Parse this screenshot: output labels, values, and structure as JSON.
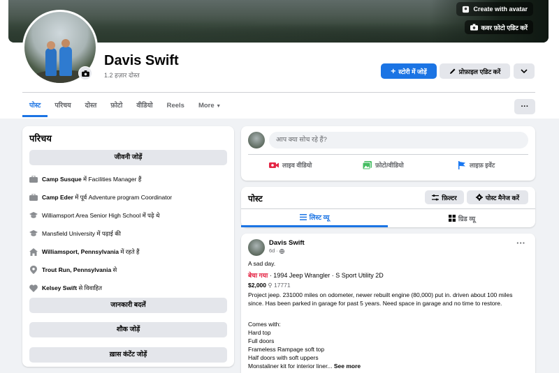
{
  "cover": {
    "create_avatar": "Create with avatar",
    "edit_cover": "कवर फ़ोटो एडिट करें"
  },
  "profile": {
    "name": "Davis Swift",
    "friends": "1.2 हज़ार दोस्त",
    "add_story": "स्टोरी में जोड़ें",
    "edit_profile": "प्रोफ़ाइल एडिट करें"
  },
  "tabs": [
    {
      "label": "पोस्ट"
    },
    {
      "label": "परिचय"
    },
    {
      "label": "दोस्त"
    },
    {
      "label": "फ़ोटो"
    },
    {
      "label": "वीडियो"
    },
    {
      "label": "Reels"
    },
    {
      "label": "More"
    }
  ],
  "intro": {
    "title": "परिचय",
    "add_bio": "जीवनी जोड़ें",
    "items": [
      {
        "bold": "Camp Susque",
        "rest": " में Facilities Manager हैं"
      },
      {
        "bold": "Camp Eder",
        "rest": " में पूर्व Adventure program Coordinator"
      },
      {
        "bold": "",
        "rest": "Williamsport Area Senior High School में पढ़े थे"
      },
      {
        "bold": "",
        "rest": "Mansfield University में पढ़ाई की"
      },
      {
        "bold": "Williamsport, Pennsylvania",
        "rest": " में रहते हैं"
      },
      {
        "bold": "Trout Run, Pennsylvania",
        "rest": " से"
      },
      {
        "bold": "Kelsey Swift",
        "rest": " से विवाहित"
      }
    ],
    "edit_details": "जानकारी बदलें",
    "add_hobbies": "शौक जोड़ें",
    "add_featured": "ख़ास कंटेंट जोड़ें"
  },
  "composer": {
    "placeholder": "आप क्या सोच रहे हैं?",
    "live": "लाइव वीडियो",
    "photo": "फ़ोटो/वीडियो",
    "event": "लाइफ़ इवेंट"
  },
  "posts_header": {
    "title": "पोस्ट",
    "filter": "फ़िल्टर",
    "manage": "पोस्ट मैनेज करें",
    "list_view": "लिस्ट व्यू",
    "grid_view": "ग्रिड व्यू"
  },
  "post": {
    "author": "Davis Swift",
    "time": "6d · ",
    "text": "A sad day.",
    "sold": "बेचा गया",
    "listing": " · 1994 Jeep Wrangler · S Sport Utility 2D",
    "price": "$2,000",
    "location": "17771",
    "description": "Project jeep. 231000 miles on odometer, newer rebuilt engine (80,000) put in. driven about 100 miles since. Has been parked in garage for past 5 years. Need space in garage and no time to restore.",
    "comes_with": "Comes with:",
    "item1": "Hard top",
    "item2": "Full doors",
    "item3": "Frameless Rampage soft top",
    "item4": "Half doors with soft uppers",
    "item5": "Monstaliner kit for interior liner...",
    "see_more": " See more"
  },
  "colors": {
    "accent": "#1b74e4",
    "sold": "#e41e3f",
    "live": "#e42645",
    "photo": "#45bd62",
    "event": "#1877f2"
  }
}
